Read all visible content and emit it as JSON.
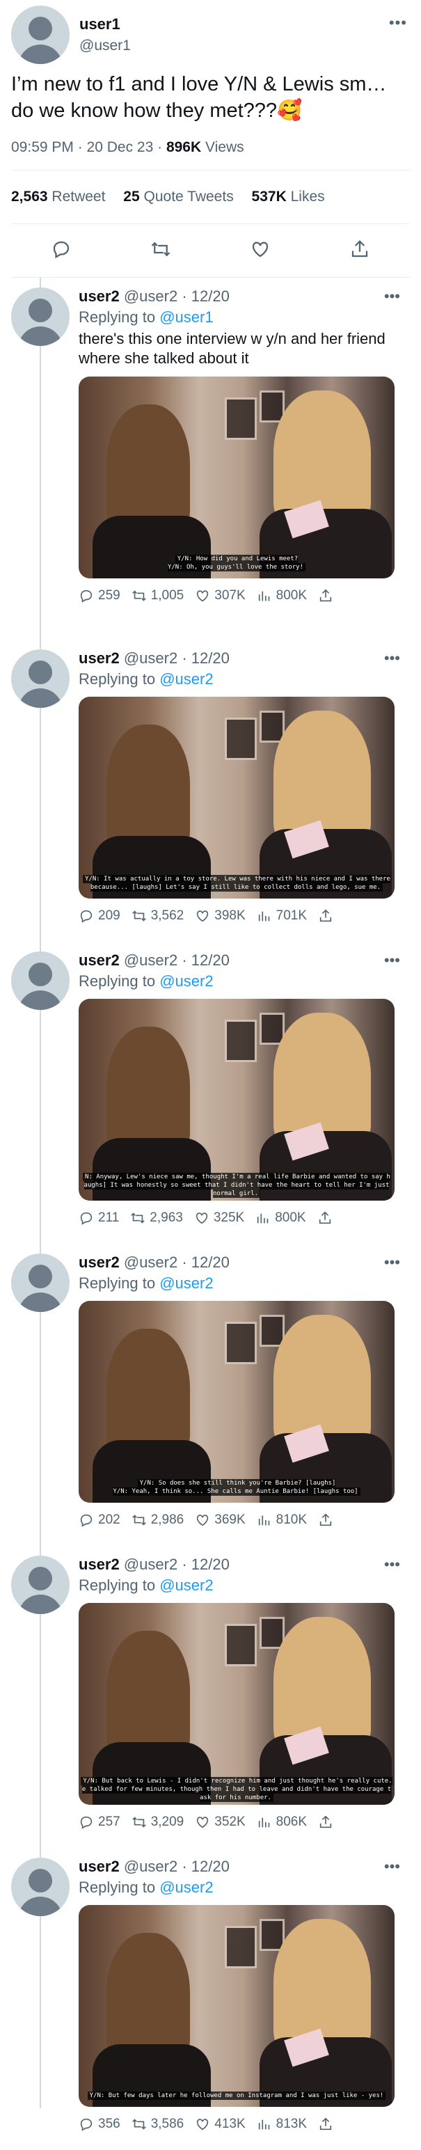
{
  "main_tweet": {
    "author_name": "user1",
    "author_handle": "@user1",
    "more_label": "•••",
    "text": "I’m new to f1 and I love Y/N & Lewis sm… do we know how they met???🥰",
    "time": "09:59 PM · 20 Dec 23 ·",
    "views_count": "896K",
    "views_label": "Views",
    "retweets_count": "2,563",
    "retweets_label": "Retweet",
    "quotes_count": "25",
    "quotes_label": "Quote Tweets",
    "likes_count": "537K",
    "likes_label": "Likes"
  },
  "icons": {
    "reply": "reply-icon",
    "retweet": "retweet-icon",
    "like": "heart-icon",
    "views": "views-icon",
    "share": "share-icon"
  },
  "colors": {
    "link": "#1d9bf0",
    "muted": "#536471",
    "text": "#0f1419",
    "divider": "#e6ecf0"
  },
  "replies": [
    {
      "name": "user2",
      "handle": "@user2",
      "date": "· 12/20",
      "replying_label": "Replying to",
      "replying_to": "@user1",
      "text": "there's this one interview w y/n and her friend where she talked about it",
      "caption": "Y/N: How did you and Lewis meet?\nY/N: Oh, you guys'll love the story!",
      "replies": "259",
      "retweets": "1,005",
      "likes": "307K",
      "views": "800K"
    },
    {
      "name": "user2",
      "handle": "@user2",
      "date": "· 12/20",
      "replying_label": "Replying to",
      "replying_to": "@user2",
      "text": "",
      "caption": "Y/N: It was actually in a toy store. Lew was there with his niece and I was there\nbecause... [laughs] Let's say I still like to collect dolls and lego, sue me.",
      "replies": "209",
      "retweets": "3,562",
      "likes": "398K",
      "views": "701K"
    },
    {
      "name": "user2",
      "handle": "@user2",
      "date": "· 12/20",
      "replying_label": "Replying to",
      "replying_to": "@user2",
      "text": "",
      "caption": "N: Anyway, Lew's niece saw me, thought I'm a real life Barbie and wanted to say h\naughs] It was honestly so sweet that I didn't have the heart to tell her I'm just\nnormal girl.",
      "replies": "211",
      "retweets": "2,963",
      "likes": "325K",
      "views": "800K"
    },
    {
      "name": "user2",
      "handle": "@user2",
      "date": "· 12/20",
      "replying_label": "Replying to",
      "replying_to": "@user2",
      "text": "",
      "caption": "Y/N: So does she still think you're Barbie? [laughs]\nY/N: Yeah, I think so... She calls me Auntie Barbie! [laughs too]",
      "replies": "202",
      "retweets": "2,986",
      "likes": "369K",
      "views": "810K"
    },
    {
      "name": "user2",
      "handle": "@user2",
      "date": "· 12/20",
      "replying_label": "Replying to",
      "replying_to": "@user2",
      "text": "",
      "caption": "Y/N: But back to Lewis - I didn't recognize him and just thought he's really cute.\ne talked for few minutes, though then I had to leave and didn't have the courage t\nask for his number.",
      "replies": "257",
      "retweets": "3,209",
      "likes": "352K",
      "views": "806K"
    },
    {
      "name": "user2",
      "handle": "@user2",
      "date": "· 12/20",
      "replying_label": "Replying to",
      "replying_to": "@user2",
      "text": "",
      "caption": "Y/N: But few days later he followed me on Instagram and I was just like - yes!",
      "replies": "356",
      "retweets": "3,586",
      "likes": "413K",
      "views": "813K"
    }
  ]
}
